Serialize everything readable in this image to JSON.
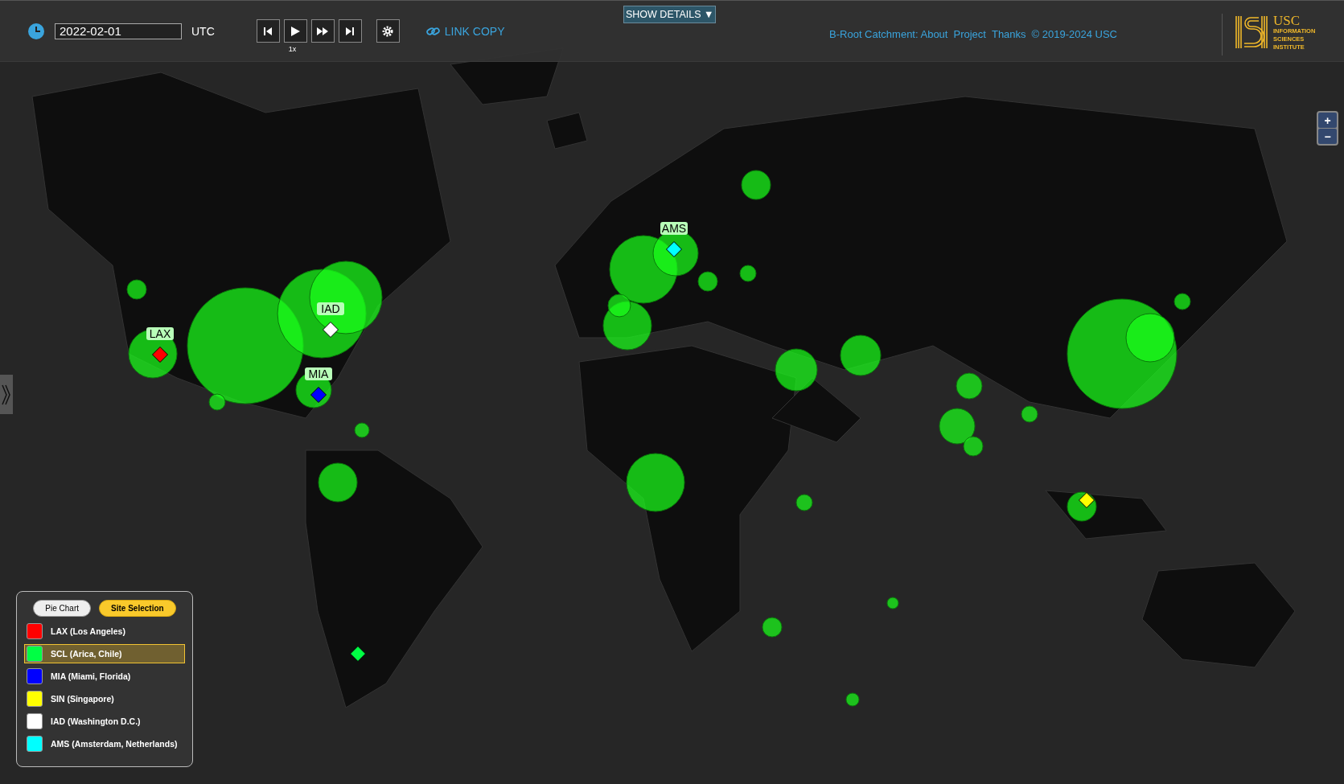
{
  "toolbar": {
    "date": "2022-02-01",
    "timezone": "UTC",
    "speed": "1x",
    "link_copy": "LINK COPY",
    "show_details": "SHOW DETAILS ▼"
  },
  "header_links": [
    "B-Root Catchment: About",
    "Project",
    "Thanks",
    "© 2019-2024 USC"
  ],
  "logo": {
    "name": "USC",
    "subtitle": [
      "INFORMATION",
      "SCIENCES",
      "INSTITUTE"
    ]
  },
  "zoom": [
    "+",
    "−"
  ],
  "legend": {
    "tabs": [
      {
        "label": "Pie Chart",
        "selected": false
      },
      {
        "label": "Site Selection",
        "selected": true
      }
    ],
    "sites": [
      {
        "label": "LAX (Los Angeles)",
        "color": "#ff0000",
        "selected": false
      },
      {
        "label": "SCL (Arica, Chile)",
        "color": "#00ff44",
        "selected": true
      },
      {
        "label": "MIA (Miami, Florida)",
        "color": "#0000ff",
        "selected": false
      },
      {
        "label": "SIN (Singapore)",
        "color": "#ffff00",
        "selected": false
      },
      {
        "label": "IAD (Washington D.C.)",
        "color": "#ffffff",
        "selected": false
      },
      {
        "label": "AMS (Amsterdam, Netherlands)",
        "color": "#00ffff",
        "selected": false
      }
    ]
  },
  "markers": [
    {
      "label": "LAX",
      "color": "#ff0000"
    },
    {
      "label": "IAD",
      "color": "#ffffff"
    },
    {
      "label": "MIA",
      "color": "#0000ff"
    },
    {
      "label": "AMS",
      "color": "#00ffff"
    },
    {
      "color": "#ffff00"
    },
    {
      "color": "#00ff44"
    }
  ]
}
